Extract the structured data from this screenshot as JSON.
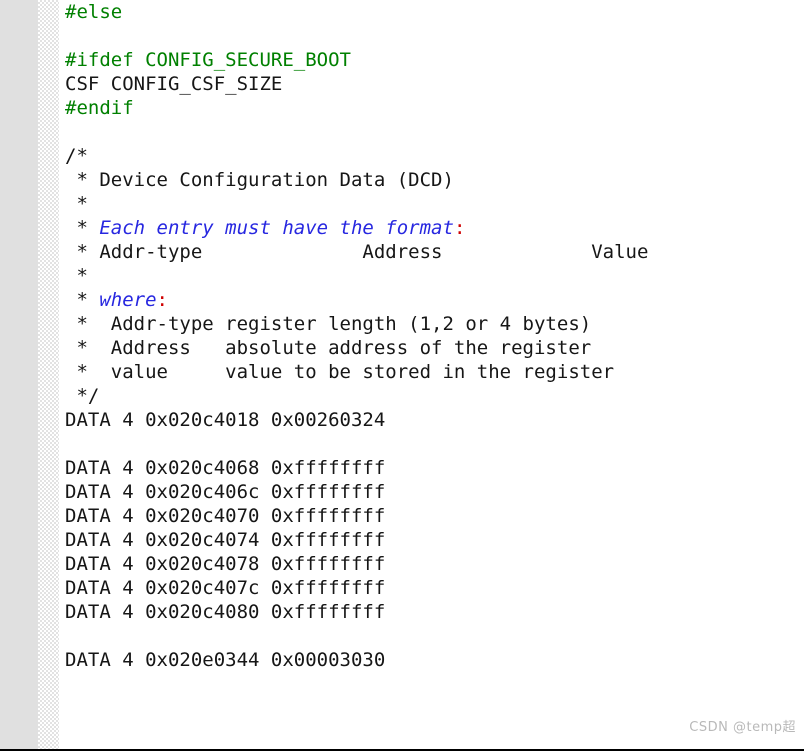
{
  "editor": {
    "language": "c-source",
    "gutter_color": "#e0e0e0",
    "background_color": "#ffffff",
    "colors": {
      "preprocessor": "#008000",
      "plain": "#161616",
      "comment_emphasis": "#2727e0",
      "punctuation_colon": "#cf0000"
    },
    "lines": [
      {
        "id": "l1",
        "segments": [
          {
            "text": "#else",
            "style": "pre"
          }
        ]
      },
      {
        "id": "l2",
        "segments": [
          {
            "text": "",
            "style": "plain"
          }
        ]
      },
      {
        "id": "l3",
        "segments": [
          {
            "text": "#ifdef CONFIG_SECURE_BOOT",
            "style": "pre"
          }
        ]
      },
      {
        "id": "l4",
        "segments": [
          {
            "text": "CSF CONFIG_CSF_SIZE",
            "style": "plain"
          }
        ]
      },
      {
        "id": "l5",
        "segments": [
          {
            "text": "#endif",
            "style": "pre"
          }
        ]
      },
      {
        "id": "l6",
        "segments": [
          {
            "text": "",
            "style": "plain"
          }
        ]
      },
      {
        "id": "l7",
        "segments": [
          {
            "text": "/*",
            "style": "cmt"
          }
        ]
      },
      {
        "id": "l8",
        "segments": [
          {
            "text": " * Device Configuration Data (DCD)",
            "style": "cmt"
          }
        ]
      },
      {
        "id": "l9",
        "segments": [
          {
            "text": " *",
            "style": "cmt"
          }
        ]
      },
      {
        "id": "l10",
        "segments": [
          {
            "text": " * ",
            "style": "cmt"
          },
          {
            "text": "Each entry must have the format",
            "style": "em"
          },
          {
            "text": ":",
            "style": "colon"
          }
        ]
      },
      {
        "id": "l11",
        "segments": [
          {
            "text": " * Addr-type              Address             Value",
            "style": "cmt"
          }
        ]
      },
      {
        "id": "l12",
        "segments": [
          {
            "text": " *",
            "style": "cmt"
          }
        ]
      },
      {
        "id": "l13",
        "segments": [
          {
            "text": " * ",
            "style": "cmt"
          },
          {
            "text": "where",
            "style": "em"
          },
          {
            "text": ":",
            "style": "colon"
          }
        ]
      },
      {
        "id": "l14",
        "segments": [
          {
            "text": " *  Addr-type register length (1,2 or 4 bytes)",
            "style": "cmt"
          }
        ]
      },
      {
        "id": "l15",
        "segments": [
          {
            "text": " *  Address   absolute address of the register",
            "style": "cmt"
          }
        ]
      },
      {
        "id": "l16",
        "segments": [
          {
            "text": " *  value     value to be stored in the register",
            "style": "cmt"
          }
        ]
      },
      {
        "id": "l17",
        "segments": [
          {
            "text": " */",
            "style": "cmt"
          }
        ]
      },
      {
        "id": "l18",
        "segments": [
          {
            "text": "DATA 4 0x020c4018 0x00260324",
            "style": "plain"
          }
        ]
      },
      {
        "id": "l19",
        "segments": [
          {
            "text": "",
            "style": "plain"
          }
        ]
      },
      {
        "id": "l20",
        "segments": [
          {
            "text": "DATA 4 0x020c4068 0xffffffff",
            "style": "plain"
          }
        ]
      },
      {
        "id": "l21",
        "segments": [
          {
            "text": "DATA 4 0x020c406c 0xffffffff",
            "style": "plain"
          }
        ]
      },
      {
        "id": "l22",
        "segments": [
          {
            "text": "DATA 4 0x020c4070 0xffffffff",
            "style": "plain"
          }
        ]
      },
      {
        "id": "l23",
        "segments": [
          {
            "text": "DATA 4 0x020c4074 0xffffffff",
            "style": "plain"
          }
        ]
      },
      {
        "id": "l24",
        "segments": [
          {
            "text": "DATA 4 0x020c4078 0xffffffff",
            "style": "plain"
          }
        ]
      },
      {
        "id": "l25",
        "segments": [
          {
            "text": "DATA 4 0x020c407c 0xffffffff",
            "style": "plain"
          }
        ]
      },
      {
        "id": "l26",
        "segments": [
          {
            "text": "DATA 4 0x020c4080 0xffffffff",
            "style": "plain"
          }
        ]
      },
      {
        "id": "l27",
        "segments": [
          {
            "text": "",
            "style": "plain"
          }
        ]
      },
      {
        "id": "l28",
        "segments": [
          {
            "text": "DATA 4 0x020e0344 0x00003030",
            "style": "plain"
          }
        ]
      }
    ]
  },
  "watermark": {
    "text": "CSDN @temp超"
  }
}
